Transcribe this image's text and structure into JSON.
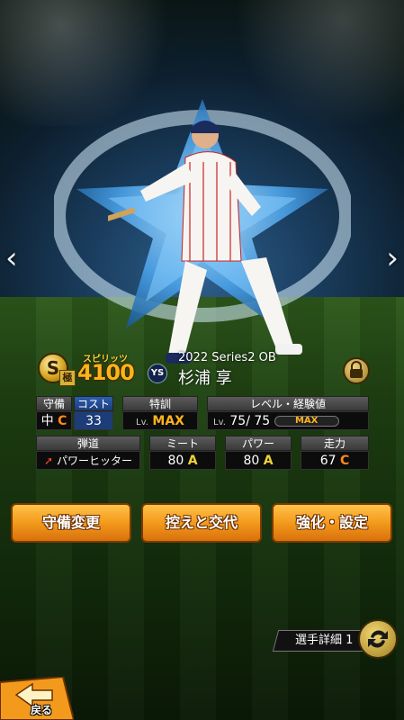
{
  "nav": {
    "prev_icon": "chevron-left-icon",
    "next_icon": "chevron-right-icon"
  },
  "card": {
    "grade_letter": "S",
    "grade_sub": "極",
    "spirit_label": "スピリッツ",
    "spirit_value": "4100",
    "team_logo_text": "YS",
    "series": "2022 Series2 OB",
    "player_name": "杉浦 享",
    "lock_icon": "lock-icon"
  },
  "stats": {
    "position_header": "守備",
    "position_name": "中",
    "position_grade": "C",
    "cost_header": "コスト",
    "cost_value": "33",
    "training_header": "特訓",
    "training_prefix": "Lv.",
    "training_value": "MAX",
    "level_header": "レベル・経験値",
    "level_prefix": "Lv.",
    "level_current": "75",
    "level_max": "75",
    "exp_value": "MAX",
    "trajectory_header": "弾道",
    "trajectory_value": "パワーヒッター",
    "meet_header": "ミート",
    "meet_value": "80",
    "meet_grade": "A",
    "power_header": "パワー",
    "power_value": "80",
    "power_grade": "A",
    "speed_header": "走力",
    "speed_value": "67",
    "speed_grade": "C"
  },
  "actions": {
    "defense_change": "守備変更",
    "bench_swap": "控えと交代",
    "enhance_settings": "強化・設定"
  },
  "detail": {
    "label": "選手詳細 1",
    "swap_icon": "swap-icon"
  },
  "back": {
    "label": "戻る"
  },
  "colors": {
    "button_orange": "#f39a1c",
    "grade_A": "#f0d23a",
    "grade_C": "#ff8a1a",
    "cost_blue": "#1d3d78"
  }
}
